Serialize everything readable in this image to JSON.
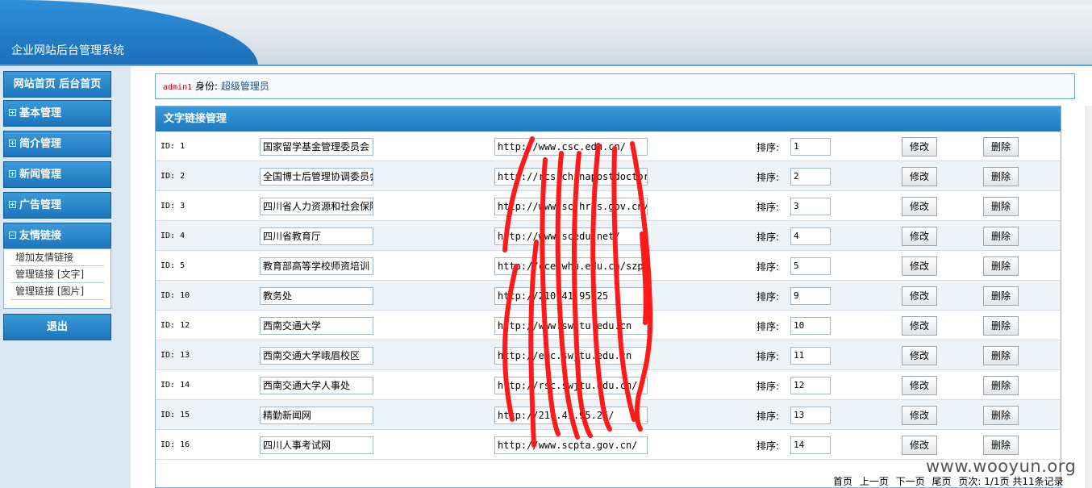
{
  "header": {
    "site_title": "企业网站后台管理系统"
  },
  "sidebar": {
    "home": "网站首页 后台首页",
    "menus": [
      {
        "label": "基本管理",
        "expanded": false
      },
      {
        "label": "简介管理",
        "expanded": false
      },
      {
        "label": "新闻管理",
        "expanded": false
      },
      {
        "label": "广告管理",
        "expanded": false
      },
      {
        "label": "友情链接",
        "expanded": true
      }
    ],
    "submenu": [
      "增加友情链接",
      "管理链接 [文字]",
      "管理链接 [图片]"
    ],
    "logout": "退出"
  },
  "userbar": {
    "username": "admin1",
    "role_label": "身份:",
    "role": "超级管理员"
  },
  "panel": {
    "title": "文字链接管理",
    "sort_label": "排序:",
    "edit_label": "修改",
    "delete_label": "删除",
    "rows": [
      {
        "id": "ID: 1",
        "name": "国家留学基金管理委员会",
        "url": "http://www.csc.edu.cn/",
        "sort": "1"
      },
      {
        "id": "ID: 2",
        "name": "全国博士后管理协调委员会",
        "url": "http://rcs.chinapostdoctor.",
        "sort": "2"
      },
      {
        "id": "ID: 3",
        "name": "四川省人力资源和社会保障厅",
        "url": "http://www.sc.hrss.gov.cn/",
        "sort": "3"
      },
      {
        "id": "ID: 4",
        "name": "四川省教育厅",
        "url": "http://www.scedu.net/",
        "sort": "4"
      },
      {
        "id": "ID: 5",
        "name": "教育部高等学校师资培训",
        "url": "http://cce.whu.edu.cn/szpx",
        "sort": "5"
      },
      {
        "id": "ID: 10",
        "name": "教务处",
        "url": "http://210.41.95.25",
        "sort": "9"
      },
      {
        "id": "ID: 12",
        "name": "西南交通大学",
        "url": "http://www.swjtu.edu.cn",
        "sort": "10"
      },
      {
        "id": "ID: 13",
        "name": "西南交通大学峨眉校区",
        "url": "http://emc.swjtu.edu.cn",
        "sort": "11"
      },
      {
        "id": "ID: 14",
        "name": "西南交通大学人事处",
        "url": "http://rsc.swjtu.edu.cn/",
        "sort": "12"
      },
      {
        "id": "ID: 15",
        "name": "精勤新闻网",
        "url": "http://210.41.95.26/",
        "sort": "13"
      },
      {
        "id": "ID: 16",
        "name": "四川人事考试网",
        "url": "http://www.scpta.gov.cn/",
        "sort": "14"
      }
    ]
  },
  "pager": {
    "first": "首页",
    "prev": "上一页",
    "next": "下一页",
    "last": "尾页",
    "info": "页次: 1/1页 共11条记录"
  },
  "watermark": "www.wooyun.org",
  "colors": {
    "accent": "#1d75bd",
    "scribble": "#ff1a1a"
  }
}
